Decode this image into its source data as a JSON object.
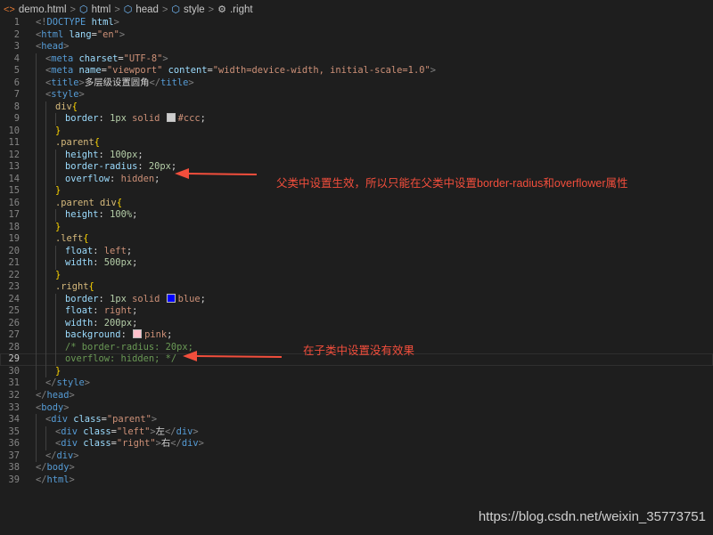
{
  "breadcrumb": {
    "items": [
      {
        "label": "demo.html",
        "icon": "html-file-icon"
      },
      {
        "label": "html",
        "icon": "cube-icon"
      },
      {
        "label": "head",
        "icon": "cube-icon"
      },
      {
        "label": "style",
        "icon": "cube-icon"
      },
      {
        "label": ".right",
        "icon": "css-selector-icon"
      }
    ],
    "separator": ">"
  },
  "colors": {
    "tag": "#569cd6",
    "bracket": "#808080",
    "attr": "#9cdcfe",
    "string": "#ce9178",
    "selector": "#d7ba7d",
    "value": "#ce9178",
    "number": "#b5cea8",
    "punct": "#d4d4d4",
    "comment": "#6a9955",
    "text": "#d4d4d4",
    "brace": "#ffd700",
    "annotation": "#f24e3c"
  },
  "lines": [
    {
      "n": "1",
      "indent": 0,
      "tokens": [
        [
          "bracket",
          "<!"
        ],
        [
          "tag",
          "DOCTYPE "
        ],
        [
          "attr",
          "html"
        ],
        [
          "bracket",
          ">"
        ]
      ]
    },
    {
      "n": "2",
      "indent": 0,
      "tokens": [
        [
          "bracket",
          "<"
        ],
        [
          "tag",
          "html "
        ],
        [
          "attr",
          "lang"
        ],
        [
          "punct",
          "="
        ],
        [
          "string",
          "\"en\""
        ],
        [
          "bracket",
          ">"
        ]
      ]
    },
    {
      "n": "3",
      "indent": 0,
      "tokens": [
        [
          "bracket",
          "<"
        ],
        [
          "tag",
          "head"
        ],
        [
          "bracket",
          ">"
        ]
      ]
    },
    {
      "n": "4",
      "indent": 1,
      "tokens": [
        [
          "bracket",
          "<"
        ],
        [
          "tag",
          "meta "
        ],
        [
          "attr",
          "charset"
        ],
        [
          "punct",
          "="
        ],
        [
          "string",
          "\"UTF-8\""
        ],
        [
          "bracket",
          ">"
        ]
      ]
    },
    {
      "n": "5",
      "indent": 1,
      "tokens": [
        [
          "bracket",
          "<"
        ],
        [
          "tag",
          "meta "
        ],
        [
          "attr",
          "name"
        ],
        [
          "punct",
          "="
        ],
        [
          "string",
          "\"viewport\" "
        ],
        [
          "attr",
          "content"
        ],
        [
          "punct",
          "="
        ],
        [
          "string",
          "\"width=device-width, initial-scale=1.0\""
        ],
        [
          "bracket",
          ">"
        ]
      ]
    },
    {
      "n": "6",
      "indent": 1,
      "tokens": [
        [
          "bracket",
          "<"
        ],
        [
          "tag",
          "title"
        ],
        [
          "bracket",
          ">"
        ],
        [
          "text",
          "多层级设置圆角"
        ],
        [
          "bracket",
          "</"
        ],
        [
          "tag",
          "title"
        ],
        [
          "bracket",
          ">"
        ]
      ]
    },
    {
      "n": "7",
      "indent": 1,
      "tokens": [
        [
          "bracket",
          "<"
        ],
        [
          "tag",
          "style"
        ],
        [
          "bracket",
          ">"
        ]
      ]
    },
    {
      "n": "8",
      "indent": 2,
      "tokens": [
        [
          "selector",
          "div"
        ],
        [
          "brace",
          "{"
        ]
      ]
    },
    {
      "n": "9",
      "indent": 3,
      "tokens": [
        [
          "attr",
          "border"
        ],
        [
          "punct",
          ": "
        ],
        [
          "number",
          "1px "
        ],
        [
          "value",
          "solid "
        ],
        [
          "swatch",
          "#cccccc"
        ],
        [
          "value",
          "#ccc"
        ],
        [
          "punct",
          ";"
        ]
      ]
    },
    {
      "n": "10",
      "indent": 2,
      "tokens": [
        [
          "brace",
          "}"
        ]
      ]
    },
    {
      "n": "11",
      "indent": 2,
      "tokens": [
        [
          "selector",
          ".parent"
        ],
        [
          "brace",
          "{"
        ]
      ]
    },
    {
      "n": "12",
      "indent": 3,
      "tokens": [
        [
          "attr",
          "height"
        ],
        [
          "punct",
          ": "
        ],
        [
          "number",
          "100px"
        ],
        [
          "punct",
          ";"
        ]
      ]
    },
    {
      "n": "13",
      "indent": 3,
      "tokens": [
        [
          "attr",
          "border-radius"
        ],
        [
          "punct",
          ": "
        ],
        [
          "number",
          "20px"
        ],
        [
          "punct",
          ";"
        ]
      ]
    },
    {
      "n": "14",
      "indent": 3,
      "tokens": [
        [
          "attr",
          "overflow"
        ],
        [
          "punct",
          ": "
        ],
        [
          "value",
          "hidden"
        ],
        [
          "punct",
          ";"
        ]
      ]
    },
    {
      "n": "15",
      "indent": 2,
      "tokens": [
        [
          "brace",
          "}"
        ]
      ]
    },
    {
      "n": "16",
      "indent": 2,
      "tokens": [
        [
          "selector",
          ".parent div"
        ],
        [
          "brace",
          "{"
        ]
      ]
    },
    {
      "n": "17",
      "indent": 3,
      "tokens": [
        [
          "attr",
          "height"
        ],
        [
          "punct",
          ": "
        ],
        [
          "number",
          "100%"
        ],
        [
          "punct",
          ";"
        ]
      ]
    },
    {
      "n": "18",
      "indent": 2,
      "tokens": [
        [
          "brace",
          "}"
        ]
      ]
    },
    {
      "n": "19",
      "indent": 2,
      "tokens": [
        [
          "selector",
          ".left"
        ],
        [
          "brace",
          "{"
        ]
      ]
    },
    {
      "n": "20",
      "indent": 3,
      "tokens": [
        [
          "attr",
          "float"
        ],
        [
          "punct",
          ": "
        ],
        [
          "value",
          "left"
        ],
        [
          "punct",
          ";"
        ]
      ]
    },
    {
      "n": "21",
      "indent": 3,
      "tokens": [
        [
          "attr",
          "width"
        ],
        [
          "punct",
          ": "
        ],
        [
          "number",
          "500px"
        ],
        [
          "punct",
          ";"
        ]
      ]
    },
    {
      "n": "22",
      "indent": 2,
      "tokens": [
        [
          "brace",
          "}"
        ]
      ]
    },
    {
      "n": "23",
      "indent": 2,
      "tokens": [
        [
          "selector",
          ".right"
        ],
        [
          "brace",
          "{"
        ]
      ]
    },
    {
      "n": "24",
      "indent": 3,
      "tokens": [
        [
          "attr",
          "border"
        ],
        [
          "punct",
          ": "
        ],
        [
          "number",
          "1px "
        ],
        [
          "value",
          "solid "
        ],
        [
          "swatch",
          "#0000ff"
        ],
        [
          "value",
          "blue"
        ],
        [
          "punct",
          ";"
        ]
      ]
    },
    {
      "n": "25",
      "indent": 3,
      "tokens": [
        [
          "attr",
          "float"
        ],
        [
          "punct",
          ": "
        ],
        [
          "value",
          "right"
        ],
        [
          "punct",
          ";"
        ]
      ]
    },
    {
      "n": "26",
      "indent": 3,
      "tokens": [
        [
          "attr",
          "width"
        ],
        [
          "punct",
          ": "
        ],
        [
          "number",
          "200px"
        ],
        [
          "punct",
          ";"
        ]
      ]
    },
    {
      "n": "27",
      "indent": 3,
      "tokens": [
        [
          "attr",
          "background"
        ],
        [
          "punct",
          ": "
        ],
        [
          "swatch",
          "#ffc0cb"
        ],
        [
          "value",
          "pink"
        ],
        [
          "punct",
          ";"
        ]
      ]
    },
    {
      "n": "28",
      "indent": 3,
      "tokens": [
        [
          "comment",
          "/* border-radius: 20px;"
        ]
      ]
    },
    {
      "n": "29",
      "indent": 3,
      "tokens": [
        [
          "comment",
          "overflow: hidden; */"
        ]
      ],
      "active": true
    },
    {
      "n": "30",
      "indent": 2,
      "tokens": [
        [
          "brace",
          "}"
        ]
      ]
    },
    {
      "n": "31",
      "indent": 1,
      "tokens": [
        [
          "bracket",
          "</"
        ],
        [
          "tag",
          "style"
        ],
        [
          "bracket",
          ">"
        ]
      ]
    },
    {
      "n": "32",
      "indent": 0,
      "tokens": [
        [
          "bracket",
          "</"
        ],
        [
          "tag",
          "head"
        ],
        [
          "bracket",
          ">"
        ]
      ]
    },
    {
      "n": "33",
      "indent": 0,
      "tokens": [
        [
          "bracket",
          "<"
        ],
        [
          "tag",
          "body"
        ],
        [
          "bracket",
          ">"
        ]
      ]
    },
    {
      "n": "34",
      "indent": 1,
      "tokens": [
        [
          "bracket",
          "<"
        ],
        [
          "tag",
          "div "
        ],
        [
          "attr",
          "class"
        ],
        [
          "punct",
          "="
        ],
        [
          "string",
          "\"parent\""
        ],
        [
          "bracket",
          ">"
        ]
      ]
    },
    {
      "n": "35",
      "indent": 2,
      "tokens": [
        [
          "bracket",
          "<"
        ],
        [
          "tag",
          "div "
        ],
        [
          "attr",
          "class"
        ],
        [
          "punct",
          "="
        ],
        [
          "string",
          "\"left\""
        ],
        [
          "bracket",
          ">"
        ],
        [
          "text",
          "左"
        ],
        [
          "bracket",
          "</"
        ],
        [
          "tag",
          "div"
        ],
        [
          "bracket",
          ">"
        ]
      ]
    },
    {
      "n": "36",
      "indent": 2,
      "tokens": [
        [
          "bracket",
          "<"
        ],
        [
          "tag",
          "div "
        ],
        [
          "attr",
          "class"
        ],
        [
          "punct",
          "="
        ],
        [
          "string",
          "\"right\""
        ],
        [
          "bracket",
          ">"
        ],
        [
          "text",
          "右"
        ],
        [
          "bracket",
          "</"
        ],
        [
          "tag",
          "div"
        ],
        [
          "bracket",
          ">"
        ]
      ]
    },
    {
      "n": "37",
      "indent": 1,
      "tokens": [
        [
          "bracket",
          "</"
        ],
        [
          "tag",
          "div"
        ],
        [
          "bracket",
          ">"
        ]
      ]
    },
    {
      "n": "38",
      "indent": 0,
      "tokens": [
        [
          "bracket",
          "</"
        ],
        [
          "tag",
          "body"
        ],
        [
          "bracket",
          ">"
        ]
      ]
    },
    {
      "n": "39",
      "indent": 0,
      "tokens": [
        [
          "bracket",
          "</"
        ],
        [
          "tag",
          "html"
        ],
        [
          "bracket",
          ">"
        ]
      ]
    }
  ],
  "annotations": {
    "parent_note": "父类中设置生效，所以只能在父类中设置border-radius和overflower属性",
    "child_note": "在子类中设置没有效果"
  },
  "watermark": "https://blog.csdn.net/weixin_35773751"
}
